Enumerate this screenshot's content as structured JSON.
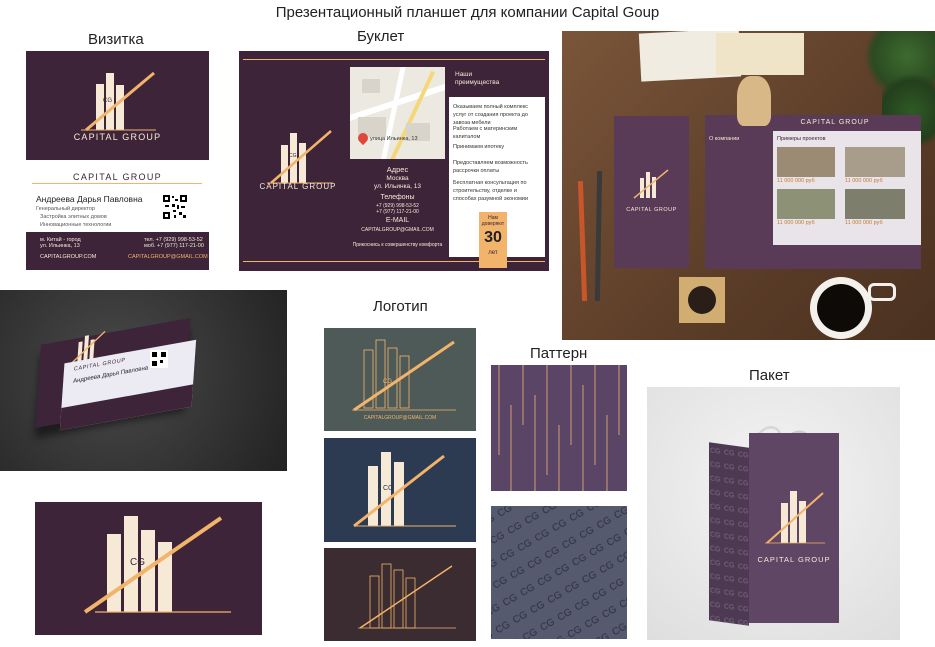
{
  "page_title": "Презентационный планшет для компании Capital Goup",
  "sections": {
    "card": "Визитка",
    "booklet": "Буклет",
    "logo": "Логотип",
    "pattern": "Паттерн",
    "bag": "Пакет"
  },
  "brand": {
    "name": "CAPITAL GROUP",
    "monogram": "CG",
    "dark": "#3d2438",
    "gold": "#f2b36b",
    "cream": "#f6ead6",
    "slate": "#4e5a58",
    "navy": "#2c3a52",
    "brown": "#3a2c30"
  },
  "business_card": {
    "brand_header": "CAPITAL GROUP",
    "person_name": "Андреева Дарья Павловна",
    "role": "Генеральный директор",
    "services": [
      "Застройка элитных домов",
      "Инновационные технологии"
    ],
    "address_line1": "м. Китай - город",
    "address_line2": "ул. Ильинка, 13",
    "phone1": "тел. +7 (929) 998-53-52",
    "phone2": "моб. +7 (977) 117-21-00",
    "website": "CAPITALGROUP.COM",
    "email": "CAPITALGROUP@GMAIL.COM"
  },
  "booklet": {
    "advantages_title": "Наши преимущества",
    "advantages": [
      "Оказываем полный комплекс услуг от создания проекта до завоза мебели",
      "Работаем с материнским капиталом",
      "Принимаем ипотеку",
      "Предоставляем возможность рассрочки оплаты",
      "Бесплатная консультация по строительству, отделке и способах разумной экономии"
    ],
    "map_label": "улица Ильинка, 13",
    "address_title": "Адрес",
    "city": "Москва",
    "street": "ул. Ильинка, 13",
    "phones_title": "Телефоны",
    "phone1": "+7 (929) 998-53-52",
    "phone2": "+7 (977) 117-21-00",
    "email_title": "E-MAIL",
    "email": "CAPITALGROUP@GMAIL.COM",
    "slogan": "Прикоснись к совершенству комфорта",
    "trust_top": "Нам доверяют",
    "trust_number": "30",
    "trust_bottom": "лет"
  },
  "mockup_booklet": {
    "about_title": "О компании",
    "examples_title": "Примеры проектов",
    "price1": "11 000 000 руб",
    "price2": "11 000 000 руб",
    "price3": "11 000 000 руб",
    "price4": "11 000 000 руб"
  }
}
